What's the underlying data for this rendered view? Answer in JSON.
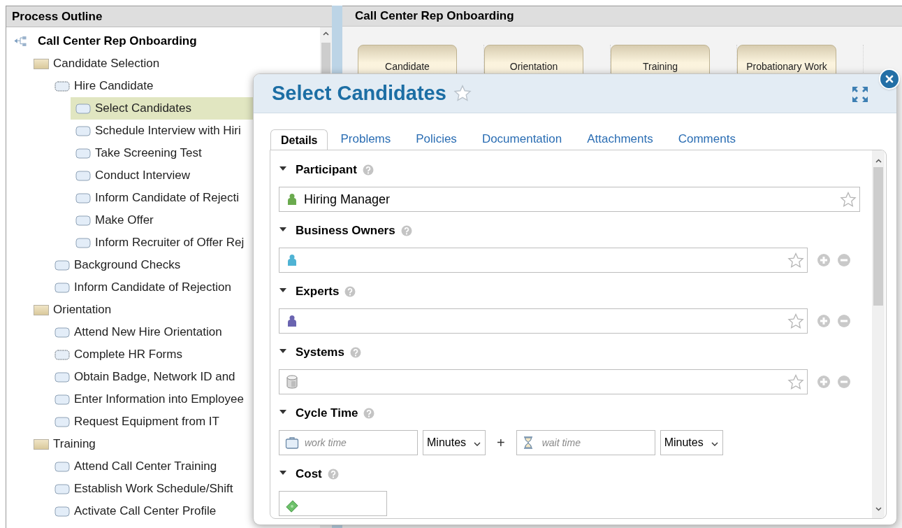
{
  "outline": {
    "title": "Process Outline",
    "tree": [
      {
        "label": "Call Center Rep Onboarding",
        "kind": "process",
        "selected": false,
        "children": [
          {
            "label": "Candidate Selection",
            "kind": "group",
            "selected": false,
            "children": [
              {
                "label": "Hire Candidate",
                "kind": "subprocess",
                "selected": false,
                "children": [
                  {
                    "label": "Select Candidates",
                    "kind": "activity",
                    "selected": true
                  },
                  {
                    "label": "Schedule Interview with Hiri",
                    "kind": "activity",
                    "selected": false
                  },
                  {
                    "label": "Take Screening Test",
                    "kind": "activity",
                    "selected": false
                  },
                  {
                    "label": "Conduct Interview",
                    "kind": "activity",
                    "selected": false
                  },
                  {
                    "label": "Inform Candidate of Rejecti",
                    "kind": "activity",
                    "selected": false
                  },
                  {
                    "label": "Make Offer",
                    "kind": "activity",
                    "selected": false
                  },
                  {
                    "label": "Inform Recruiter of Offer Rej",
                    "kind": "activity",
                    "selected": false
                  }
                ]
              },
              {
                "label": "Background Checks",
                "kind": "activity",
                "selected": false
              },
              {
                "label": "Inform Candidate of Rejection",
                "kind": "activity",
                "selected": false
              }
            ]
          },
          {
            "label": "Orientation",
            "kind": "group",
            "selected": false,
            "children": [
              {
                "label": "Attend New Hire Orientation",
                "kind": "activity",
                "selected": false
              },
              {
                "label": "Complete HR Forms",
                "kind": "subprocess",
                "selected": false
              },
              {
                "label": "Obtain Badge, Network ID and",
                "kind": "activity",
                "selected": false
              },
              {
                "label": "Enter Information into Employee",
                "kind": "activity",
                "selected": false
              },
              {
                "label": "Request Equipment from IT",
                "kind": "activity",
                "selected": false
              }
            ]
          },
          {
            "label": "Training",
            "kind": "group",
            "selected": false,
            "children": [
              {
                "label": "Attend Call Center Training",
                "kind": "activity",
                "selected": false
              },
              {
                "label": "Establish Work Schedule/Shift",
                "kind": "activity",
                "selected": false
              },
              {
                "label": "Activate Call Center Profile",
                "kind": "activity",
                "selected": false
              }
            ]
          }
        ]
      }
    ]
  },
  "diagram": {
    "title": "Call Center Rep Onboarding",
    "stages": [
      {
        "label": "Candidate"
      },
      {
        "label": "Orientation"
      },
      {
        "label": "Training"
      },
      {
        "label": "Probationary Work"
      }
    ]
  },
  "dialog": {
    "title": "Select Candidates",
    "tabs": [
      {
        "label": "Details",
        "selected": true
      },
      {
        "label": "Problems",
        "selected": false
      },
      {
        "label": "Policies",
        "selected": false
      },
      {
        "label": "Documentation",
        "selected": false
      },
      {
        "label": "Attachments",
        "selected": false
      },
      {
        "label": "Comments",
        "selected": false
      }
    ],
    "sections": [
      {
        "label": "Participant",
        "kind": "people",
        "expanded": true,
        "value": "Hiring Manager",
        "color": "#6aaa4e",
        "multiple": false
      },
      {
        "label": "Business Owners",
        "kind": "people",
        "expanded": true,
        "color": "#4fb3d4",
        "multiple": true
      },
      {
        "label": "Experts",
        "kind": "people",
        "expanded": true,
        "color": "#6a64b0",
        "multiple": true
      },
      {
        "label": "Systems",
        "kind": "systems",
        "expanded": true,
        "multiple": true
      },
      {
        "label": "Cycle Time",
        "kind": "cycle",
        "expanded": true,
        "work": {
          "placeholder": "work time",
          "unit": "Minutes"
        },
        "operator": "+",
        "wait": {
          "placeholder": "wait time",
          "unit": "Minutes"
        }
      },
      {
        "label": "Cost",
        "kind": "cost",
        "expanded": true
      }
    ]
  }
}
